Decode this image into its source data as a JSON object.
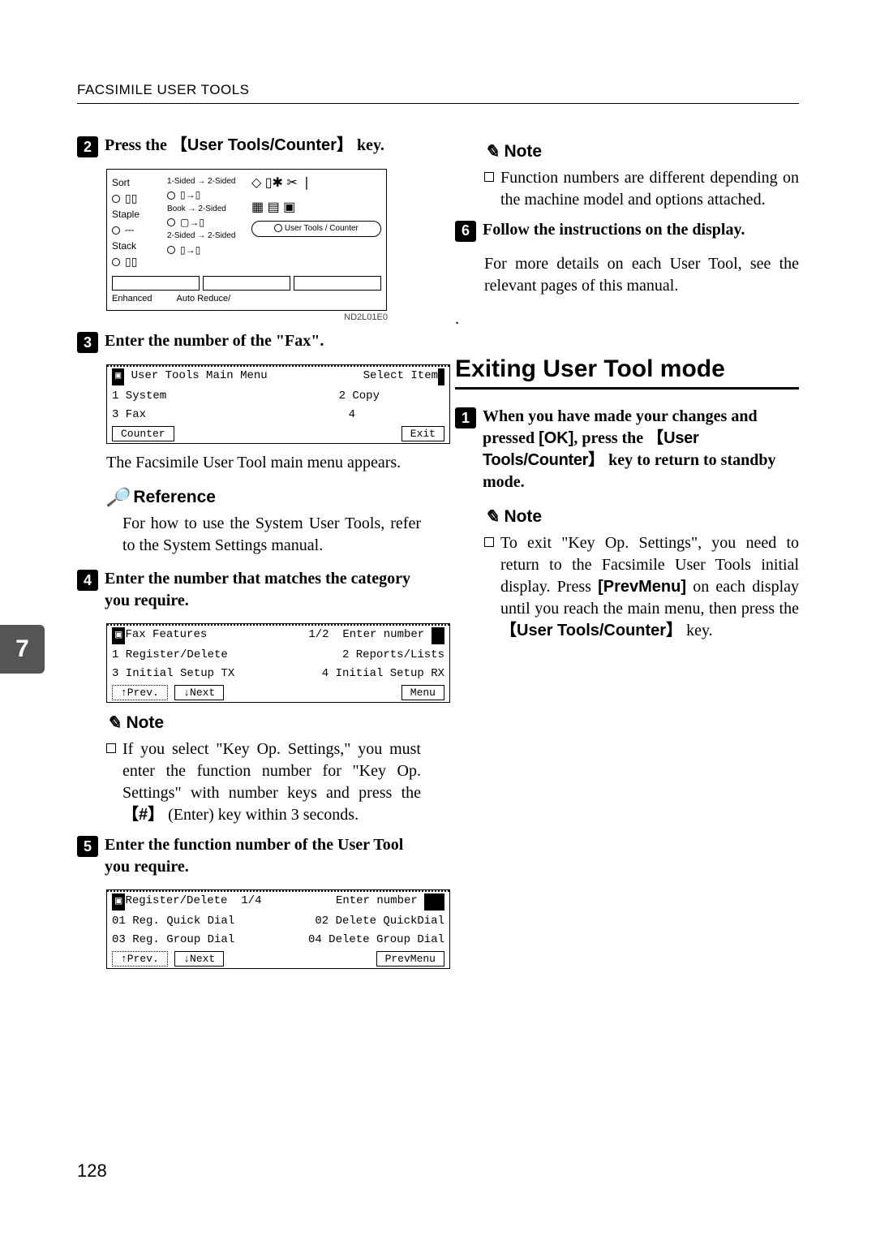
{
  "header": "FACSIMILE USER TOOLS",
  "page_number": "128",
  "side_tab": "7",
  "panel": {
    "label_sort": "Sort",
    "label_staple": "Staple",
    "label_stack": "Stack",
    "m1": "1-Sided → 2-Sided",
    "m2": "Book → 2-Sided",
    "m3": "2-Sided → 2-Sided",
    "user_tools": "User Tools / Counter",
    "enhanced": "Enhanced",
    "auto": "Auto Reduce/",
    "code": "ND2L01E0"
  },
  "left": {
    "step2": {
      "pre": "Press the ",
      "btn_open": "【",
      "btn": "User Tools/Counter",
      "btn_close": "】",
      "post": " key."
    },
    "step3": "Enter the number of the \"Fax\".",
    "lcd1": {
      "title_icon": "☐",
      "title": "User Tools Main Menu",
      "right": "Select Item",
      "r1a": "1 System",
      "r1b": "2 Copy",
      "r2a": "3 Fax",
      "r2b": "4",
      "btn1": "Counter",
      "btn2": "Exit"
    },
    "body3": "The Facsimile User Tool main menu appears.",
    "reference_label": "Reference",
    "reference_body": "For how to use the System User Tools, refer to the System Settings manual.",
    "step4": "Enter the number that matches the category you require.",
    "lcd2": {
      "title": "Fax Features",
      "page": "1/2",
      "right": "Enter number",
      "r1a": "1 Register/Delete",
      "r1b": "2 Reports/Lists",
      "r2a": "3 Initial Setup TX",
      "r2b": "4 Initial Setup RX",
      "btn_prev": "↑Prev.",
      "btn_next": "↓Next",
      "btn_menu": "Menu"
    },
    "note_label_1": "Note",
    "note4_pre": "If you select \"Key Op. Settings,\" you must enter the function number for \"Key Op. Settings\" with number keys and press the ",
    "note4_key_open": "【",
    "note4_key": "#",
    "note4_key_close": "】",
    "note4_post": " (Enter) key within 3 seconds.",
    "step5": "Enter the function number of the User Tool you require.",
    "lcd3": {
      "title": "Register/Delete",
      "page": "1/4",
      "right": "Enter number",
      "r1a": "01 Reg. Quick Dial",
      "r1b": "02 Delete QuickDial",
      "r2a": "03 Reg. Group Dial",
      "r2b": "04 Delete Group Dial",
      "btn_prev": "↑Prev.",
      "btn_next": "↓Next",
      "btn_menu": "PrevMenu"
    }
  },
  "right": {
    "note_label": "Note",
    "note_top": "Function numbers are different depending on the machine model and options attached.",
    "step6": "Follow the instructions on the display.",
    "body6": "For more details on each User Tool, see the relevant pages of this manual.",
    "dot": ".",
    "section_title": "Exiting User Tool mode",
    "step1_pre": "When you have made your changes and pressed ",
    "step1_ok": "[OK]",
    "step1_mid": ", press the ",
    "step1_utc_open": "【",
    "step1_utc": "User Tools/Counter",
    "step1_utc_close": "】",
    "step1_post": " key to return to standby mode.",
    "note2_label": "Note",
    "note2_pre": "To exit \"Key Op. Settings\", you need to return to the Facsimile User Tools initial display. Press ",
    "note2_prevmenu": "[PrevMenu]",
    "note2_mid": " on each display until you reach the main menu, then press the ",
    "note2_utc_open": "【",
    "note2_utc": "User Tools/Counter",
    "note2_utc_close": "】",
    "note2_post": " key."
  }
}
